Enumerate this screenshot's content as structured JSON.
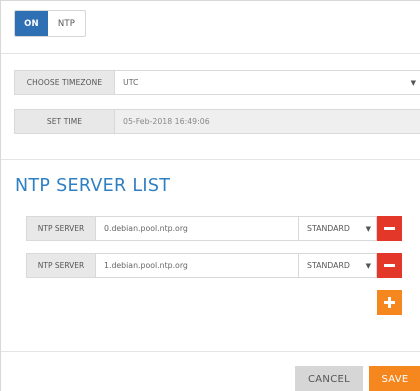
{
  "mode_toggle": {
    "on_label": "ON",
    "ntp_label": "NTP"
  },
  "settings": {
    "timezone": {
      "label": "CHOOSE TIMEZONE",
      "value": "UTC"
    },
    "set_time": {
      "label": "SET TIME",
      "value": "05-Feb-2018 16:49:06"
    }
  },
  "ntp": {
    "title": "NTP SERVER LIST",
    "servers": [
      {
        "label": "NTP SERVER",
        "address": "0.debian.pool.ntp.org",
        "mode": "STANDARD"
      },
      {
        "label": "NTP SERVER",
        "address": "1.debian.pool.ntp.org",
        "mode": "STANDARD"
      }
    ]
  },
  "actions": {
    "cancel_label": "CANCEL",
    "save_label": "SAVE"
  },
  "colors": {
    "toggle_active": "#2f6fb4",
    "title": "#2f7fc3",
    "remove": "#e3372a",
    "add": "#f6871f",
    "save": "#f6871f"
  },
  "icons": {
    "caret": "caret-down-icon",
    "remove": "minus-icon",
    "add": "plus-icon"
  }
}
